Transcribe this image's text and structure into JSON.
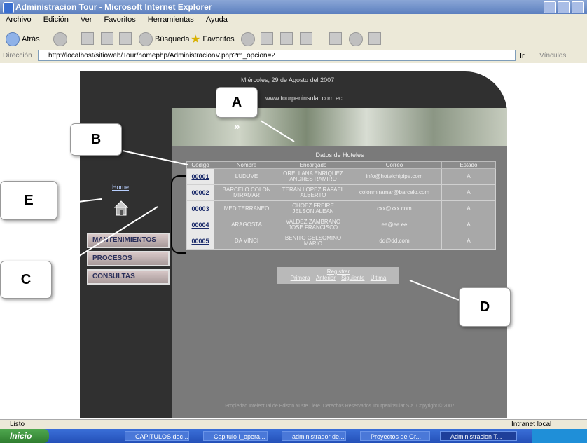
{
  "window": {
    "title": "Administracion Tour - Microsoft Internet Explorer"
  },
  "menu": [
    "Archivo",
    "Edición",
    "Ver",
    "Favoritos",
    "Herramientas",
    "Ayuda"
  ],
  "toolbar": {
    "back": "Atrás",
    "search": "Búsqueda",
    "favorites": "Favoritos"
  },
  "address": {
    "label": "Dirección",
    "url": "http://localhost/sitioweb/Tour/homephp/AdministracionV.php?m_opcion=2",
    "go": "Ir",
    "links": "Vínculos"
  },
  "page": {
    "date": "Miércoles, 29 de Agosto del 2007",
    "site_url": "www.tourpeninsular.com.ec",
    "table_title": "Datos de Hoteles",
    "headers": [
      "Código",
      "Nombre",
      "Encargado",
      "Correo",
      "Estado"
    ],
    "rows": [
      {
        "code": "00001",
        "name": "LUDUVE",
        "manager": "ORELLANA ENRIQUEZ ANDRES RAMIRO",
        "email": "info@hotelchipipe.com",
        "status": "A"
      },
      {
        "code": "00002",
        "name": "BARCELO COLON MIRAMAR",
        "manager": "TERAN LOPEZ RAFAEL ALBERTO",
        "email": "colonmiramar@barcelo.com",
        "status": "A"
      },
      {
        "code": "00003",
        "name": "MEDITERRANEO",
        "manager": "CHOEZ FREIRE JELSON ALEAN",
        "email": "cxx@xxx.com",
        "status": "A"
      },
      {
        "code": "00004",
        "name": "ARAGOSTA",
        "manager": "VALDEZ ZAMBRANO JOSE FRANCISCO",
        "email": "ee@ee.ee",
        "status": "A"
      },
      {
        "code": "00005",
        "name": "DA VINCI",
        "manager": "BENITO GELSOMINO MARIO",
        "email": "dd@dd.com",
        "status": "A"
      }
    ],
    "pager": {
      "register": "Registrar",
      "links": [
        "Primera",
        "Anterior",
        "Siguiente",
        "Última"
      ]
    },
    "footer": "Propiedad Intelectual de Edison Yuste Llere. Derechos Reservados Tourpeninsular S.a. Copyright © 2007",
    "sidebar": {
      "home": "Home",
      "menu": [
        "MANTENIMIENTOS",
        "PROCESOS",
        "CONSULTAS"
      ]
    }
  },
  "callouts": {
    "a": "A",
    "b": "B",
    "c": "C",
    "d": "D",
    "e": "E"
  },
  "status": {
    "left": "Listo",
    "right": "Intranet local"
  },
  "taskbar": {
    "start": "Inicio",
    "tasks": [
      "CAPITULOS doc ...",
      "Capitulo I_opera...",
      "administrador de...",
      "Proyectos de Gr...",
      "Administracion T..."
    ]
  }
}
